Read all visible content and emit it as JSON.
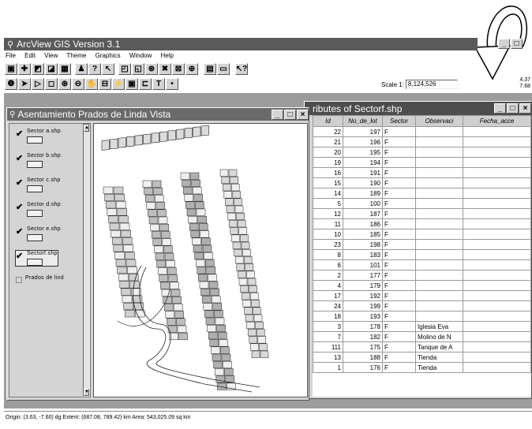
{
  "app": {
    "title": "ArcView GIS Version 3.1",
    "menu": [
      "File",
      "Edit",
      "View",
      "Theme",
      "Graphics",
      "Window",
      "Help"
    ],
    "scale_label": "Scale 1:",
    "scale_value": "8,124,526",
    "coord_top": "4.37",
    "coord_bottom": "7.68",
    "status": "Origin: (3.63, -7.60) dg  Extent: (687.08, 789.42) km  Area: 543,025.09 sq km"
  },
  "view_window": {
    "title": "Asentamiento Prados de Linda Vista",
    "themes": [
      {
        "label": "Sector a.shp",
        "checked": true
      },
      {
        "label": "Sector b.shp",
        "checked": true
      },
      {
        "label": "Sector c.shp",
        "checked": true
      },
      {
        "label": "Sector d.shp",
        "checked": true
      },
      {
        "label": "Sector e.shp",
        "checked": true
      },
      {
        "label": "Sectorf.shp",
        "checked": true,
        "active": true
      },
      {
        "label": "Prados de lind",
        "checked": false
      }
    ]
  },
  "table_window": {
    "title": "ributes of Sectorf.shp",
    "columns": [
      "Id",
      "No_de_lot",
      "Sector",
      "Observaci",
      "Fecha_acce"
    ],
    "rows": [
      [
        "22",
        "197",
        "F",
        "",
        ""
      ],
      [
        "21",
        "196",
        "F",
        "",
        ""
      ],
      [
        "20",
        "195",
        "F",
        "",
        ""
      ],
      [
        "19",
        "194",
        "F",
        "",
        ""
      ],
      [
        "16",
        "191",
        "F",
        "",
        ""
      ],
      [
        "15",
        "190",
        "F",
        "",
        ""
      ],
      [
        "14",
        "189",
        "F",
        "",
        ""
      ],
      [
        "5",
        "100",
        "F",
        "",
        ""
      ],
      [
        "12",
        "187",
        "F",
        "",
        ""
      ],
      [
        "11",
        "186",
        "F",
        "",
        ""
      ],
      [
        "10",
        "185",
        "F",
        "",
        ""
      ],
      [
        "23",
        "198",
        "F",
        "",
        ""
      ],
      [
        "8",
        "183",
        "F",
        "",
        ""
      ],
      [
        "6",
        "101",
        "F",
        "",
        ""
      ],
      [
        "2",
        "177",
        "F",
        "",
        ""
      ],
      [
        "4",
        "179",
        "F",
        "",
        ""
      ],
      [
        "17",
        "192",
        "F",
        "",
        ""
      ],
      [
        "24",
        "199",
        "F",
        "",
        ""
      ],
      [
        "18",
        "193",
        "F",
        "",
        ""
      ],
      [
        "3",
        "178",
        "F",
        "Iglesia Eva",
        ""
      ],
      [
        "7",
        "182",
        "F",
        "Molino de N",
        ""
      ],
      [
        "111",
        "175",
        "F",
        "Tanque de A",
        ""
      ],
      [
        "13",
        "188",
        "F",
        "Tienda",
        ""
      ],
      [
        "1",
        "176",
        "F",
        "Tienda",
        ""
      ]
    ]
  }
}
